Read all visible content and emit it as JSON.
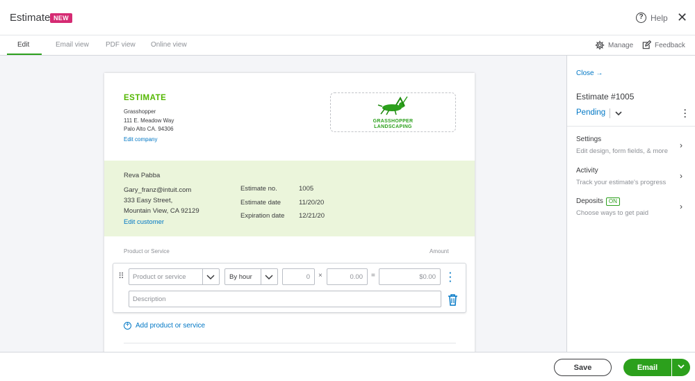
{
  "header": {
    "title": "Estimate",
    "badge": "NEW",
    "help_label": "Help",
    "close_icon": "close-icon"
  },
  "tabs": [
    {
      "label": "Edit",
      "active": true
    },
    {
      "label": "Email view",
      "active": false
    },
    {
      "label": "PDF view",
      "active": false
    },
    {
      "label": "Online view",
      "active": false
    }
  ],
  "toolbar": {
    "manage_label": "Manage",
    "feedback_label": "Feedback"
  },
  "document": {
    "heading": "ESTIMATE",
    "company": {
      "name": "Grasshopper",
      "address_line1": "111 E. Meadow Way",
      "address_line2": "Palo Alto CA. 94306",
      "edit_link": "Edit company"
    },
    "logo_text_line1": "GRASSHOPPER",
    "logo_text_line2": "LANDSCAPING",
    "customer": {
      "name": "Reva Pabba",
      "email": "Gary_franz@intuit.com",
      "address_line1": "333 Easy Street,",
      "address_line2": "Mountain View, CA 92129",
      "edit_link": "Edit customer"
    },
    "meta": [
      {
        "label": "Estimate no.",
        "value": "1005"
      },
      {
        "label": "Estimate date",
        "value": "11/20/20"
      },
      {
        "label": "Expiration date",
        "value": "12/21/20"
      }
    ],
    "columns": {
      "product": "Product or Service",
      "amount": "Amount"
    },
    "line_item": {
      "product_placeholder": "Product or service",
      "rate_type": "By hour",
      "quantity": "0",
      "rate": "0.00",
      "amount": "$0.00",
      "description_placeholder": "Description",
      "times_symbol": "×",
      "equals_symbol": "="
    },
    "add_item_label": "Add product or service"
  },
  "panel": {
    "close_label": "Close",
    "estimate_number": "Estimate #1005",
    "status": "Pending",
    "sections": [
      {
        "title": "Settings",
        "subtitle": "Edit design, form fields, & more"
      },
      {
        "title": "Activity",
        "subtitle": "Track your estimate's progress"
      },
      {
        "title": "Deposits",
        "badge": "ON",
        "subtitle": "Choose ways to get paid"
      }
    ]
  },
  "footer": {
    "save_label": "Save",
    "email_label": "Email"
  },
  "colors": {
    "brand_green": "#2ca01c",
    "heading_green": "#53b700",
    "link_blue": "#0077c5",
    "new_badge": "#d52b73",
    "customer_band": "#ebf5db"
  }
}
